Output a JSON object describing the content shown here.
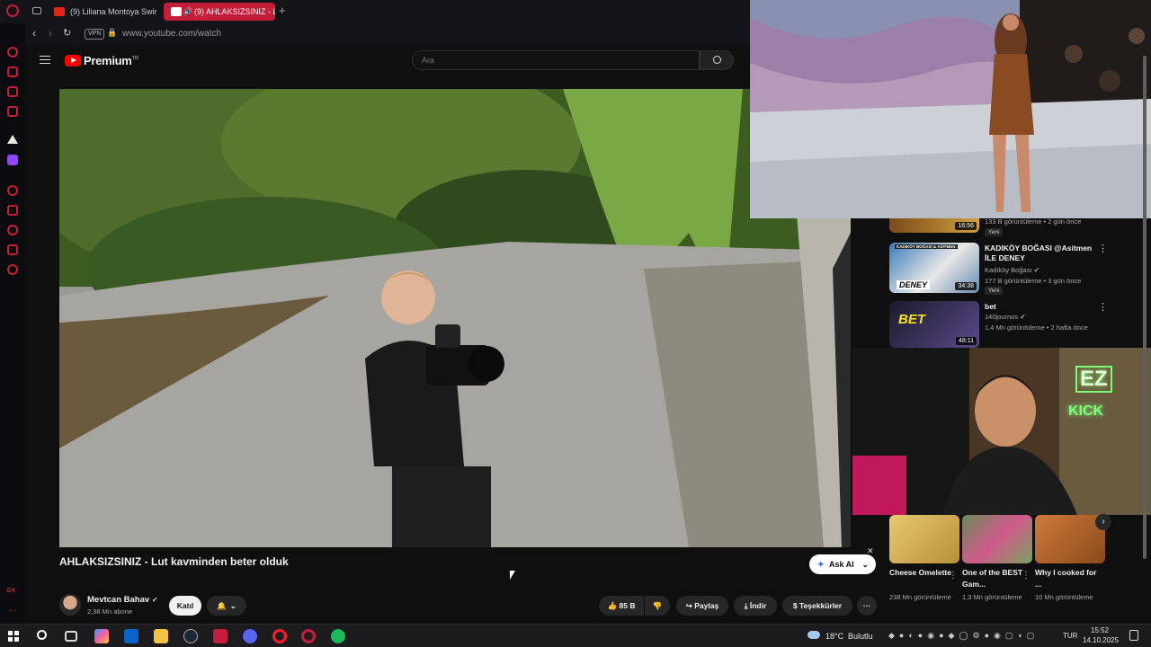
{
  "browser": {
    "tabs": [
      {
        "label": "(9) Liliana Montoya Swim"
      },
      {
        "label": "(9) AHLAKSIZSINIZ - L"
      }
    ],
    "vpn_label": "VPN",
    "url": "www.youtube.com/watch"
  },
  "youtube": {
    "logo_text": "Premium",
    "logo_superscript": "TR",
    "search_placeholder": "Ara",
    "video": {
      "title": "AHLAKSIZSINIZ - Lut kavminden beter olduk",
      "ask_ai_label": "Ask AI",
      "channel_name": "Mevtcan Bahav",
      "subscribers": "2,38 Mn abone",
      "join_label": "Katıl",
      "likes": "85 B",
      "share_label": "Paylaş",
      "download_label": "İndir",
      "thanks_label": "Teşekkürler"
    },
    "recommended": [
      {
        "duration": "16:56",
        "meta": "133 B görüntüleme • 2 gün önce",
        "badge": "Yeni"
      },
      {
        "title": "KADIKÖY BOĞASI @Asitmen İLE DENEY",
        "channel": "Kadıköy Boğası",
        "duration": "34:38",
        "thumb_text": "DENEY",
        "thumb_header": "KADIKÖY BOĞASI & ASİTMEN",
        "meta": "177 B görüntüleme • 3 gün önce",
        "badge": "Yeni"
      },
      {
        "title": "bet",
        "channel": "140journos",
        "duration": "48:11",
        "thumb_text": "BET",
        "meta": "1,4 Mn görüntüleme • 2 hafta önce"
      }
    ],
    "shorts": [
      {
        "title": "Cheese Omelette",
        "meta": "238 Mn görüntüleme"
      },
      {
        "title": "One of the BEST Gam...",
        "meta": "1,3 Mn görüntüleme"
      },
      {
        "title": "Why I cooked for ...",
        "meta": "10 Mn görüntüleme"
      }
    ]
  },
  "overlays": {
    "webcam_neon": [
      "EZ",
      "KICK"
    ]
  },
  "taskbar": {
    "weather": "18°C",
    "weather_desc": "Bulutlu",
    "language": "TUR",
    "time": "15:52",
    "date": "14.10.2025"
  },
  "colors": {
    "opera_red": "#c41e3a",
    "youtube_red": "#ff0000",
    "background": "#0f0f0f",
    "neon_green": "#7dff7a"
  }
}
